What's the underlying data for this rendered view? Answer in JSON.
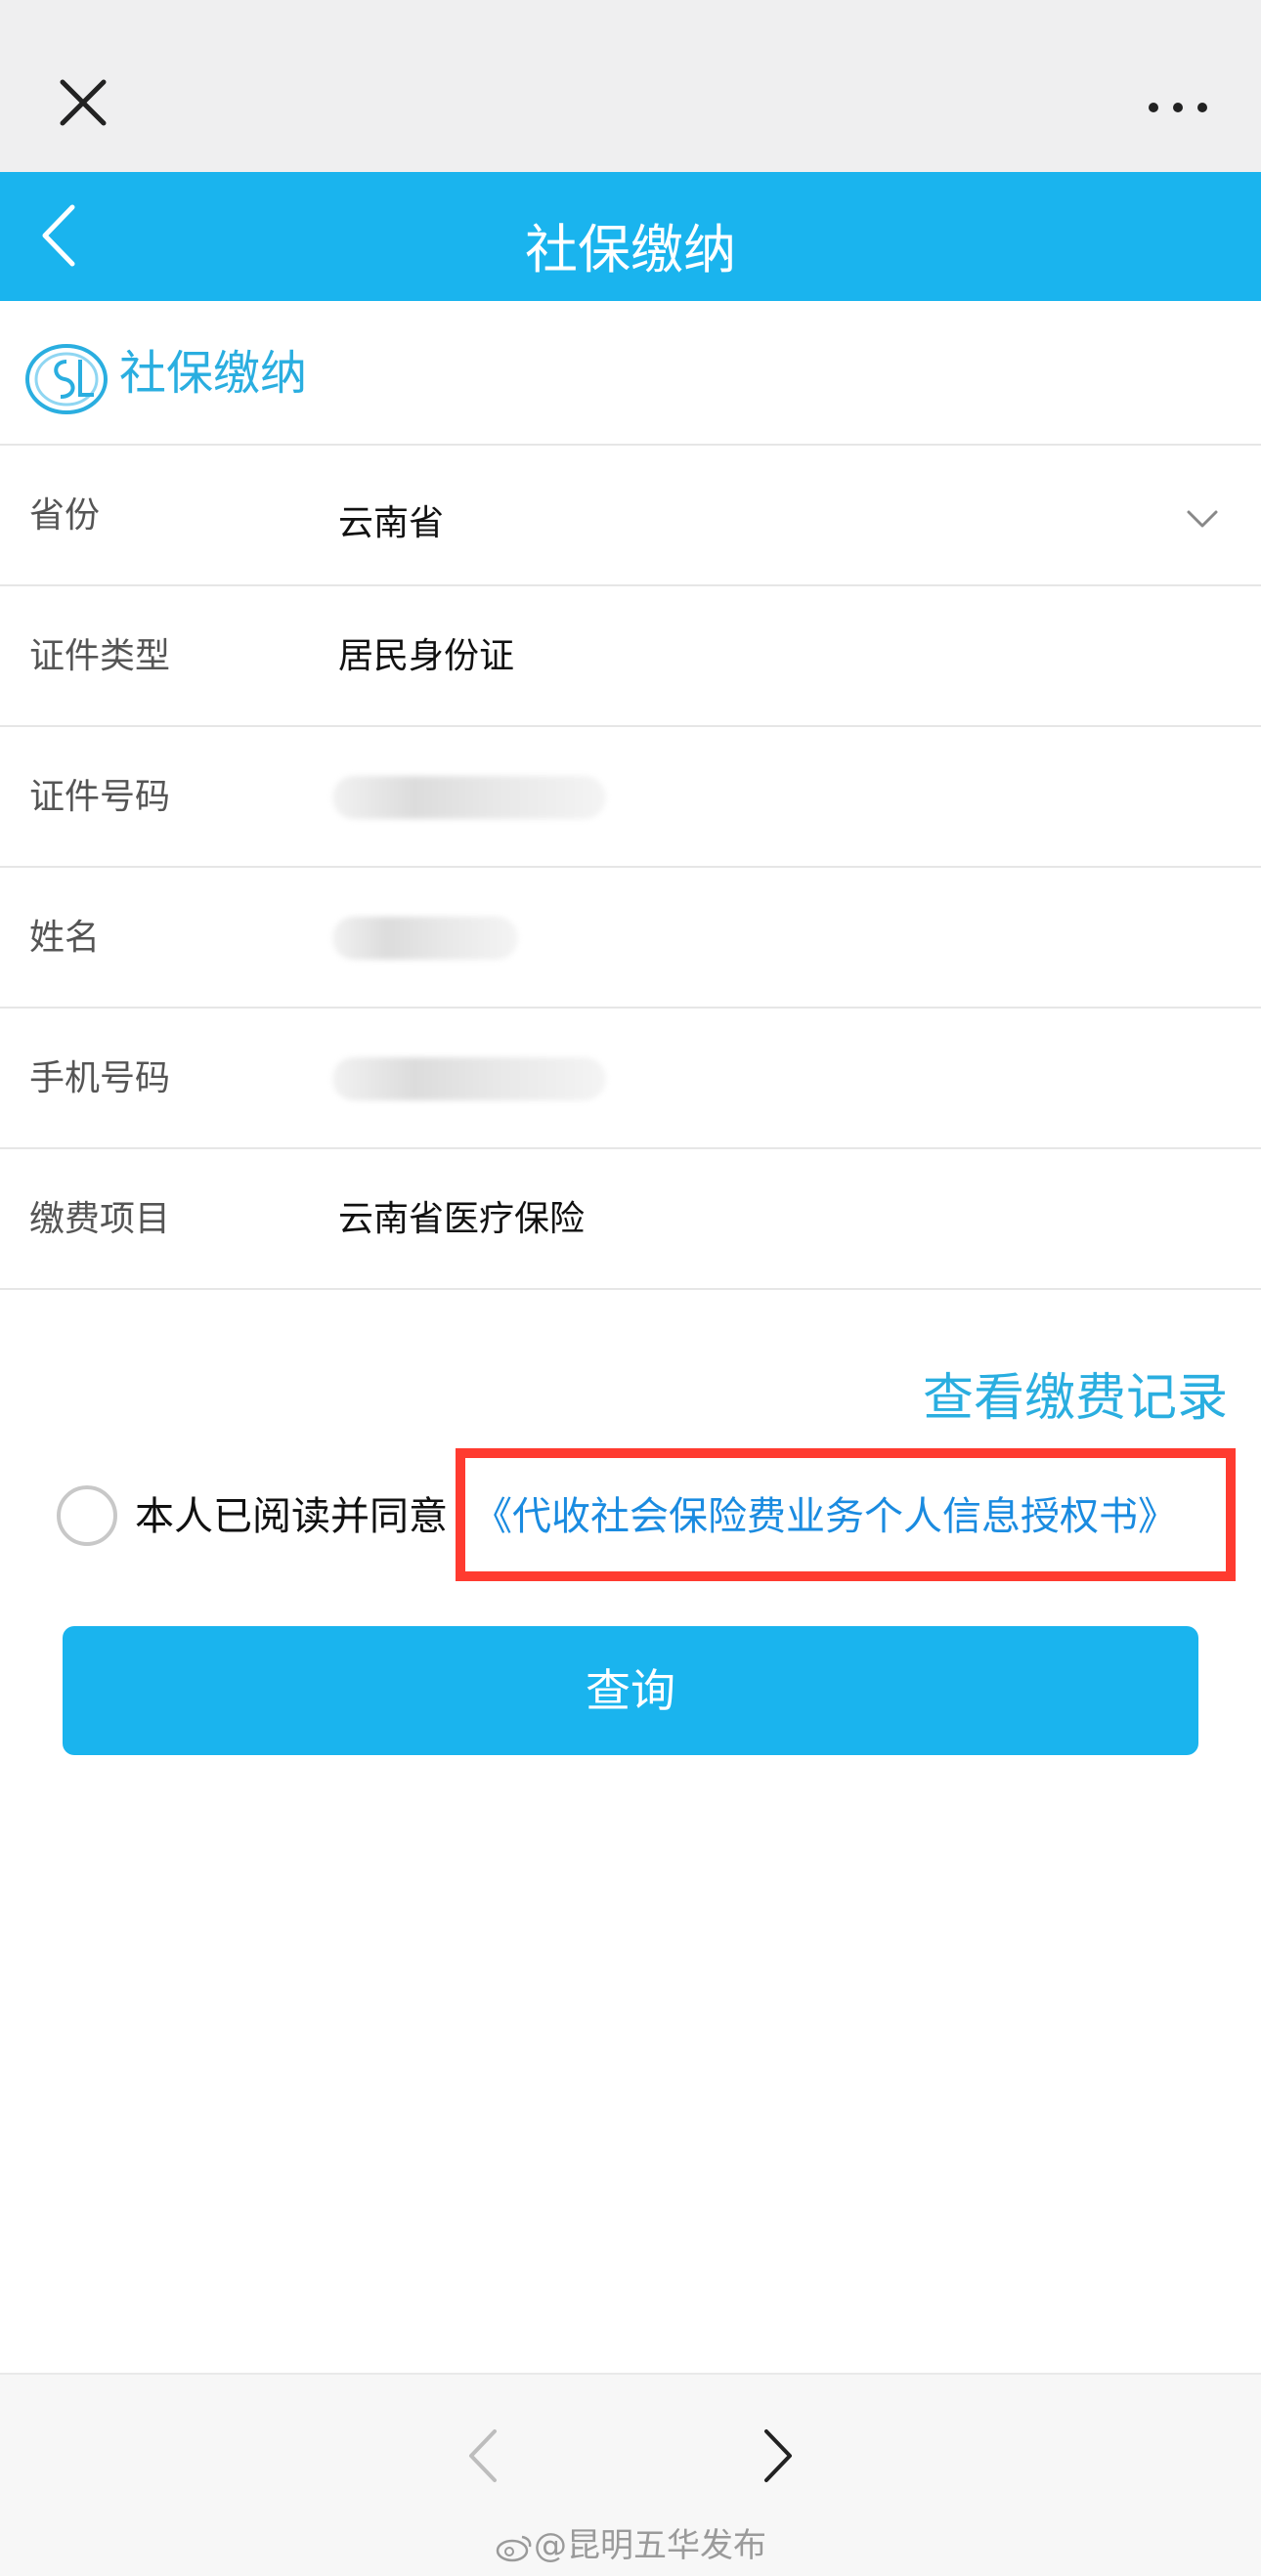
{
  "header": {
    "title": "社保缴纳"
  },
  "brand": {
    "name": "社保缴纳"
  },
  "form": {
    "rows": [
      {
        "label": "省份",
        "value": "云南省"
      },
      {
        "label": "证件类型",
        "value": "居民身份证"
      },
      {
        "label": "证件号码",
        "value": ""
      },
      {
        "label": "姓名",
        "value": ""
      },
      {
        "label": "手机号码",
        "value": ""
      },
      {
        "label": "缴费项目",
        "value": "云南省医疗保险"
      }
    ]
  },
  "record_link": "查看缴费记录",
  "agreement": {
    "text": "本人已阅读并同意",
    "link": "《代收社会保险费业务个人信息授权书》",
    "checked": false
  },
  "query_button": "查询",
  "watermark": "@昆明五华发布",
  "colors": {
    "primary": "#1ab4ee",
    "link": "#1a8be0",
    "highlight": "#ff3b30"
  }
}
